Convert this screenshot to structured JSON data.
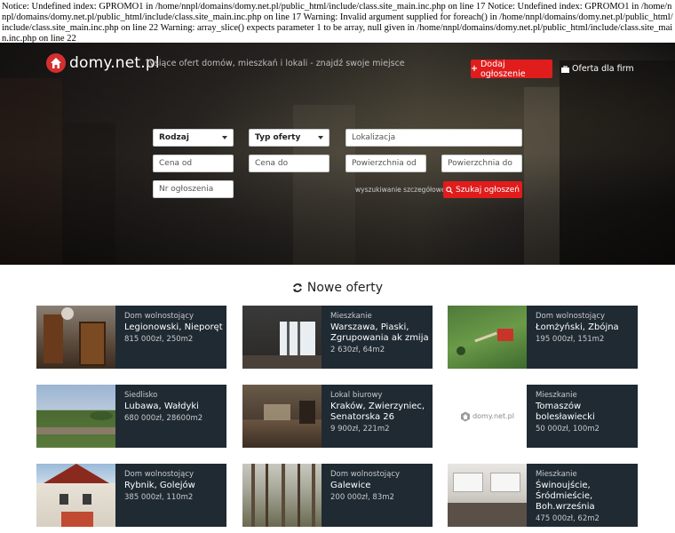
{
  "notice": "Notice: Undefined index: GPROMO1 in /home/nnpl/domains/domy.net.pl/public_html/include/class.site_main.inc.php on line 17 Notice: Undefined index: GPROMO1 in /home/nnpl/domains/domy.net.pl/public_html/include/class.site_main.inc.php on line 17 Warning: Invalid argument supplied for foreach() in /home/nnpl/domains/domy.net.pl/public_html/include/class.site_main.inc.php on line 22 Warning: array_slice() expects parameter 1 to be array, null given in /home/nnpl/domains/domy.net.pl/public_html/include/class.site_main.inc.php on line 22",
  "header": {
    "logo_text": "domy.net.pl",
    "tagline": "Tysiące ofert domów, mieszkań i lokali - znajdź swoje miejsce",
    "add_button": "Dodaj ogłoszenie",
    "firms_link": "Oferta dla firm"
  },
  "search": {
    "rodzaj": "Rodzaj",
    "typ": "Typ oferty",
    "lokalizacja": "Lokalizacja",
    "cena_od": "Cena od",
    "cena_do": "Cena do",
    "pow_od": "Powierzchnia od",
    "pow_do": "Powierzchnia do",
    "nr": "Nr ogłoszenia",
    "advanced": "wyszukiwanie szczegółowe",
    "submit": "Szukaj ogłoszeń"
  },
  "section_title": "Nowe oferty",
  "cards": [
    {
      "type": "Dom wolnostojący",
      "loc": "Legionowski, Nieporęt",
      "price": "815 000zł, 250m2"
    },
    {
      "type": "Mieszkanie",
      "loc": "Warszawa, Piaski, Zgrupowania ak zmija",
      "price": "2 630zł, 64m2"
    },
    {
      "type": "Dom wolnostojący",
      "loc": "Łomżyński, Zbójna",
      "price": "195 000zł, 151m2"
    },
    {
      "type": "Siedlisko",
      "loc": "Lubawa, Wałdyki",
      "price": "680 000zł, 28600m2"
    },
    {
      "type": "Lokal biurowy",
      "loc": "Kraków, Zwierzyniec, Senatorska 26",
      "price": "9 900zł, 221m2"
    },
    {
      "type": "Mieszkanie",
      "loc": "Tomaszów bolesławiecki",
      "price": "50 000zł, 100m2"
    },
    {
      "type": "Dom wolnostojący",
      "loc": "Rybnik, Golejów",
      "price": "385 000zł, 110m2"
    },
    {
      "type": "Dom wolnostojący",
      "loc": "Galewice",
      "price": "200 000zł, 83m2"
    },
    {
      "type": "Mieszkanie",
      "loc": "Świnoujście, Śródmieście, Boh.września",
      "price": "475 000zł, 62m2"
    }
  ],
  "placeholder_logo": "domy.net.pl"
}
